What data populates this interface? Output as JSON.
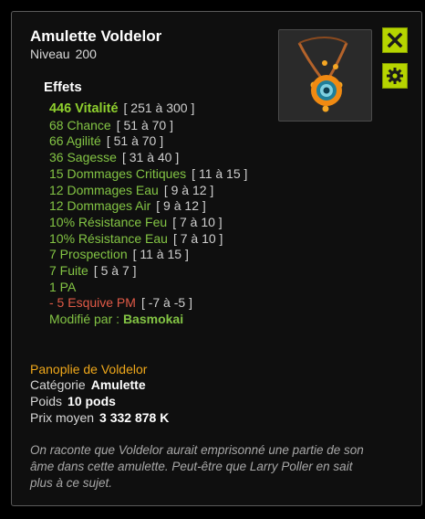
{
  "item": {
    "name": "Amulette Voldelor",
    "level_label": "Niveau",
    "level": "200"
  },
  "icons": {
    "close": "close-icon",
    "settings": "gear-icon",
    "item": "amulet-icon"
  },
  "colors": {
    "accent_button": "#b6d400",
    "effect_positive": "#83c444",
    "effect_negative": "#e05a47",
    "set_name": "#f0a81a"
  },
  "effects": {
    "title": "Effets",
    "items": [
      {
        "name": "446 Vitalité",
        "range": "[ 251 à 300 ]"
      },
      {
        "name": "68 Chance",
        "range": "[ 51 à 70 ]"
      },
      {
        "name": "66 Agilité",
        "range": "[ 51 à 70 ]"
      },
      {
        "name": "36 Sagesse",
        "range": "[ 31 à 40 ]"
      },
      {
        "name": "15 Dommages Critiques",
        "range": "[ 11 à 15 ]"
      },
      {
        "name": "12 Dommages Eau",
        "range": "[ 9 à 12 ]"
      },
      {
        "name": "12 Dommages Air",
        "range": "[ 9 à 12 ]"
      },
      {
        "name": "10% Résistance Feu",
        "range": "[ 7 à 10 ]"
      },
      {
        "name": "10% Résistance Eau",
        "range": "[ 7 à 10 ]"
      },
      {
        "name": "7 Prospection",
        "range": "[ 11 à 15 ]"
      },
      {
        "name": "7 Fuite",
        "range": "[ 5 à 7 ]"
      },
      {
        "name": "1 PA",
        "range": ""
      },
      {
        "name": "- 5 Esquive PM",
        "range": "[ -7 à -5 ]"
      }
    ],
    "modified_by_label": "Modifié par :",
    "modified_by": "Basmokai"
  },
  "set": {
    "name": "Panoplie de Voldelor"
  },
  "details": {
    "category_label": "Catégorie",
    "category": "Amulette",
    "weight_label": "Poids",
    "weight": "10 pods",
    "price_label": "Prix moyen",
    "price": "3 332 878 K"
  },
  "description": "On raconte que Voldelor aurait emprisonné une partie de son âme dans cette amulette. Peut-être que Larry Poller en sait plus à ce sujet."
}
